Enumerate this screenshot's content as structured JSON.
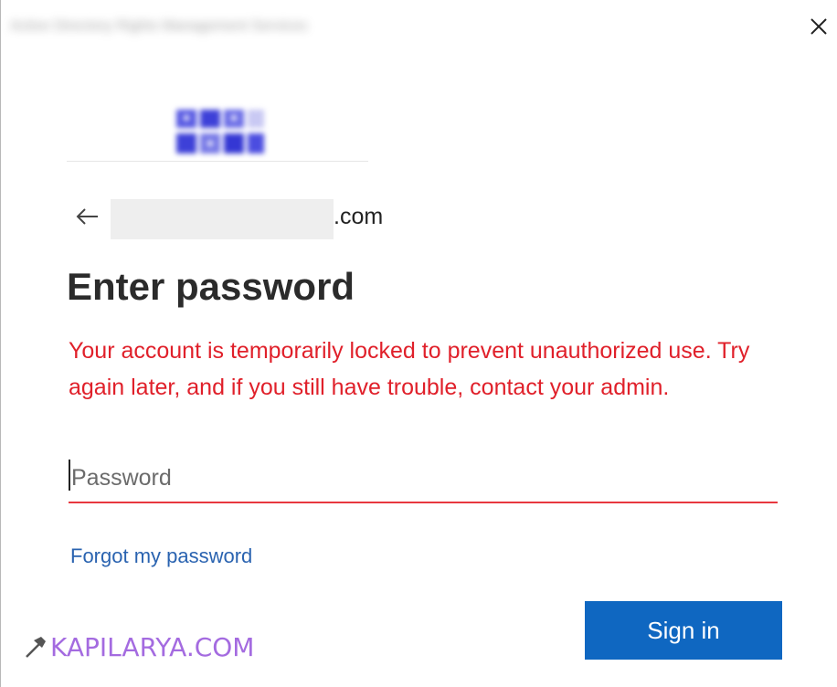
{
  "window": {
    "title": "Active Directory Rights Management Services",
    "close_icon": "close-icon"
  },
  "logo": {
    "icon": "organization-logo",
    "color": "#4a4de0"
  },
  "identity": {
    "back_icon": "arrow-left-icon",
    "email_domain": ".com"
  },
  "heading": "Enter password",
  "error": {
    "message": "Your account is temporarily locked to prevent unauthorized use. Try again later, and if you still have trouble, contact your admin.",
    "color": "#e0202a"
  },
  "password": {
    "placeholder": "Password",
    "value": ""
  },
  "links": {
    "forgot_password": "Forgot my password"
  },
  "actions": {
    "sign_in": "Sign in",
    "accent": "#0f67c1"
  },
  "watermark": {
    "text": "KAPILARYA.COM",
    "icon": "hammer-icon",
    "color": "#a46be0"
  }
}
